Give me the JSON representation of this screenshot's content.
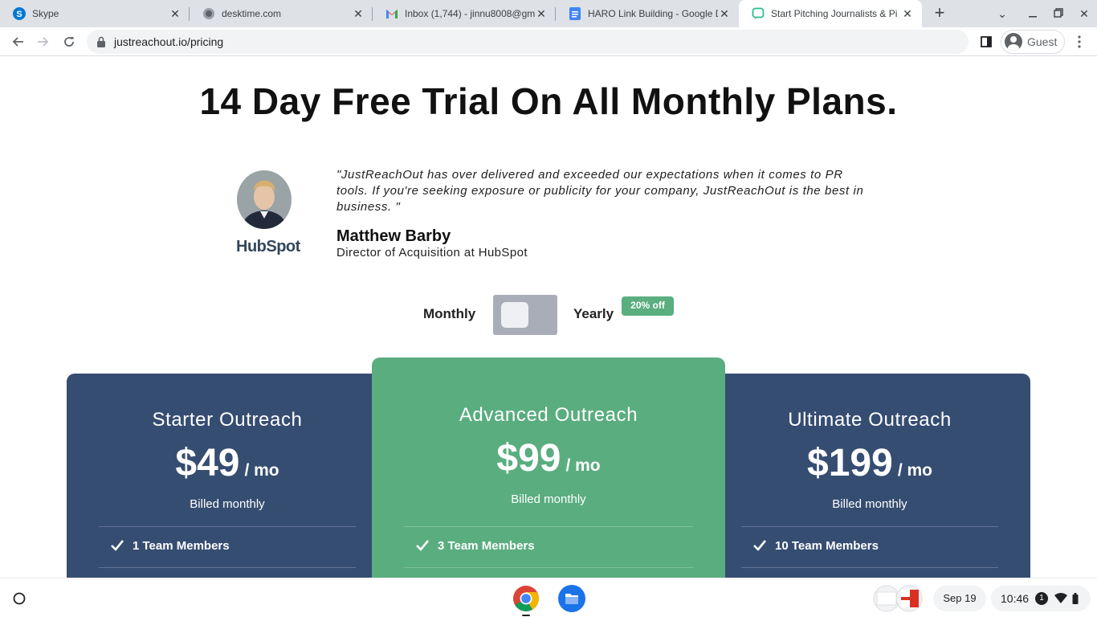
{
  "browser": {
    "tabs": [
      {
        "title": "Skype",
        "icon": "skype-icon"
      },
      {
        "title": "desktime.com",
        "icon": "globe-icon"
      },
      {
        "title": "Inbox (1,744) - jinnu8008@gm",
        "icon": "gmail-icon"
      },
      {
        "title": "HARO Link Building - Google D",
        "icon": "docs-icon"
      },
      {
        "title": "Start Pitching Journalists & Pi",
        "icon": "justreachout-icon",
        "active": true
      }
    ],
    "url": "justreachout.io/pricing",
    "profile_label": "Guest"
  },
  "page": {
    "headline": "14 Day Free Trial On All Monthly Plans.",
    "testimonial": {
      "quote": "\"JustReachOut has over delivered and exceeded our expectations when it comes to PR tools. If you're seeking exposure or publicity for your company, JustReachOut is the best in business. \"",
      "author": "Matthew Barby",
      "role": "Director of Acquisition at HubSpot",
      "company_logo": "HubSpot"
    },
    "billing": {
      "monthly_label": "Monthly",
      "yearly_label": "Yearly",
      "discount_badge": "20% off",
      "selected": "Monthly"
    },
    "plans": [
      {
        "name": "Starter Outreach",
        "currency": "$",
        "price": "49",
        "per": "/ mo",
        "billed": "Billed monthly",
        "feature": "1 Team Members",
        "color": "#364d72"
      },
      {
        "name": "Advanced Outreach",
        "currency": "$",
        "price": "99",
        "per": "/ mo",
        "billed": "Billed monthly",
        "feature": "3 Team Members",
        "color": "#5aad7f"
      },
      {
        "name": "Ultimate Outreach",
        "currency": "$",
        "price": "199",
        "per": "/ mo",
        "billed": "Billed monthly",
        "feature": "10 Team Members",
        "color": "#364d72"
      }
    ]
  },
  "shelf": {
    "date": "Sep 19",
    "time": "10:46",
    "notification_count": "1"
  }
}
